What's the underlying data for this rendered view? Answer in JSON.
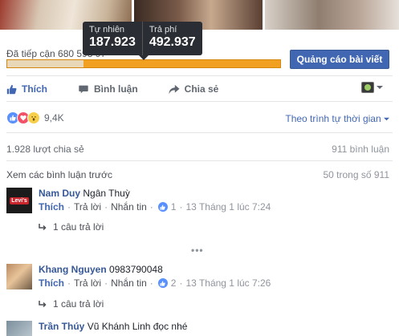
{
  "reach": {
    "label": "Đã tiếp cận 680",
    "hidden_tail": "593 97",
    "organic_fraction": 0.28,
    "boost_label": "Quảng cáo bài viết"
  },
  "tooltip": {
    "organic_label": "Tự nhiên",
    "organic_value": "187.923",
    "paid_label": "Trả phí",
    "paid_value": "492.937"
  },
  "actions": {
    "like": "Thích",
    "comment": "Bình luận",
    "share": "Chia sẻ"
  },
  "reactions": {
    "count": "9,4K",
    "sort_label": "Theo trình tự thời gian"
  },
  "stats": {
    "shares": "1.928 lượt chia sẻ",
    "comments": "911 bình luận"
  },
  "previous": {
    "label": "Xem các bình luận trước",
    "count": "50 trong số 911"
  },
  "comments": [
    {
      "name": "Nam Duy",
      "text": "Ngân Thuỳ",
      "like": "Thích",
      "reply": "Trả lời",
      "message": "Nhắn tin",
      "likes": "1",
      "time": "13 Tháng 1 lúc 7:24",
      "replies": "1 câu trả lời",
      "avatar_text": "Levi's"
    },
    {
      "name": "Khang Nguyen",
      "text": "0983790048",
      "like": "Thích",
      "reply": "Trả lời",
      "message": "Nhắn tin",
      "likes": "2",
      "time": "13 Tháng 1 lúc 7:26",
      "replies": "1 câu trả lời"
    },
    {
      "name": "Trần Thúy",
      "text": "Vũ Khánh Linh đọc nhé"
    }
  ],
  "colors": {
    "fb_blue": "#4267b2",
    "reach_bar": "#f2a021",
    "tooltip_bg": "#2a2d33"
  }
}
